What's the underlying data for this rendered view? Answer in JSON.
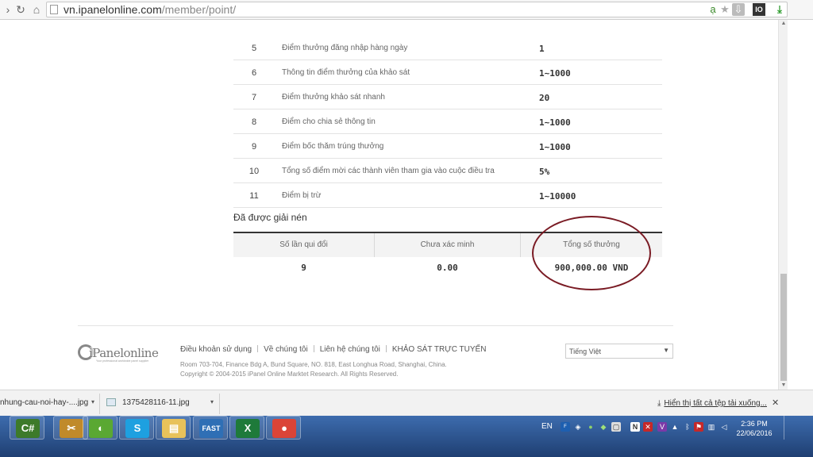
{
  "browser": {
    "url_host": "vn.ipanelonline.com",
    "url_path": "/member/point/"
  },
  "points_rows": [
    {
      "no": "5",
      "desc": "Điểm thưởng đăng nhập hàng ngày",
      "points": "1"
    },
    {
      "no": "6",
      "desc": "Thông tin điểm thưởng của khảo sát",
      "points": "1~1000"
    },
    {
      "no": "7",
      "desc": "Điểm thưởng khảo sát nhanh",
      "points": "20"
    },
    {
      "no": "8",
      "desc": "Điểm cho chia sẻ thông tin",
      "points": "1~1000"
    },
    {
      "no": "9",
      "desc": "Điểm bốc thăm trúng thưởng",
      "points": "1~1000"
    },
    {
      "no": "10",
      "desc": "Tổng số điểm mời các thành viên tham gia vào cuộc điều tra",
      "points": "5%"
    },
    {
      "no": "11",
      "desc": "Điểm bị trừ",
      "points": "1~10000"
    }
  ],
  "summary": {
    "title": "Đã được giải nén",
    "headers": [
      "Số lần qui đổi",
      "Chưa xác minh",
      "Tổng số thưởng"
    ],
    "values": [
      "9",
      "0.00",
      "900,000.00 VND"
    ]
  },
  "footer": {
    "logo_name": "iPanelonline",
    "logo_tagline": "Your professional worldwide panel supplier",
    "links": [
      "Điều khoản sử dụng",
      "Về chúng tôi",
      "Liên hệ chúng tôi",
      "KHẢO SÁT TRỰC TUYẾN"
    ],
    "address": "Room 703-704, Finance Bdg A, Bund Square, NO. 818, East Longhua Road, Shanghai, China.",
    "copyright": "Copyright © 2004-2015 iPanel Online Marktet Research. All Rights Reserved.",
    "language": "Tiếng Việt"
  },
  "downloads": {
    "items": [
      "nhung-cau-noi-hay-....jpg",
      "1375428116-11.jpg"
    ],
    "show_all": "Hiển thị tất cả tệp tải xuống..."
  },
  "taskbar": {
    "lang": "EN",
    "time": "2:36 PM",
    "date": "22/06/2016",
    "apps": [
      {
        "name": "csharp",
        "glyph": "C#",
        "color": "#3d7a2a"
      },
      {
        "name": "tools",
        "glyph": "✂",
        "color": "#c08a2a"
      },
      {
        "name": "tune",
        "glyph": "◐",
        "color": "#5aa832"
      },
      {
        "name": "skype",
        "glyph": "S",
        "color": "#1ea0e0"
      },
      {
        "name": "explorer",
        "glyph": "▤",
        "color": "#e8c25a"
      },
      {
        "name": "fast",
        "glyph": "FAST",
        "color": "#2f6fb5"
      },
      {
        "name": "excel",
        "glyph": "X",
        "color": "#1e7a3a"
      },
      {
        "name": "chrome",
        "glyph": "●",
        "color": "#db4437"
      }
    ]
  }
}
